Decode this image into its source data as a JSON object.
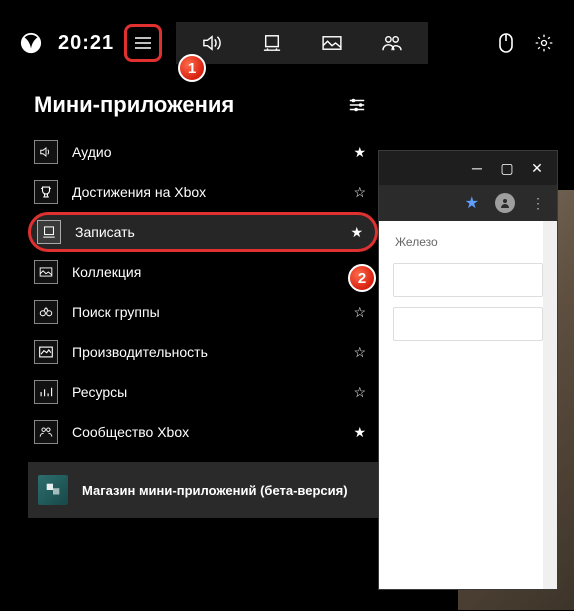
{
  "top": {
    "time": "20:21",
    "tabs": [
      "audio-icon",
      "capture-icon",
      "gallery-icon",
      "social-icon"
    ]
  },
  "panel": {
    "title": "Мини-приложения",
    "items": [
      {
        "icon": "speaker-icon",
        "label": "Аудио",
        "starred": true
      },
      {
        "icon": "trophy-icon",
        "label": "Достижения на Xbox",
        "starred": false
      },
      {
        "icon": "record-icon",
        "label": "Записать",
        "starred": true,
        "highlight": true
      },
      {
        "icon": "collection-icon",
        "label": "Коллекция",
        "starred": false
      },
      {
        "icon": "binoculars-icon",
        "label": "Поиск группы",
        "starred": false
      },
      {
        "icon": "performance-icon",
        "label": "Производительность",
        "starred": false
      },
      {
        "icon": "resources-icon",
        "label": "Ресурсы",
        "starred": false
      },
      {
        "icon": "community-icon",
        "label": "Сообщество Xbox",
        "starred": true
      }
    ],
    "shop_label": "Магазин мини-приложений (бета-версия)"
  },
  "bg_window": {
    "section_label": "Железо"
  },
  "callouts": {
    "one": "1",
    "two": "2"
  }
}
